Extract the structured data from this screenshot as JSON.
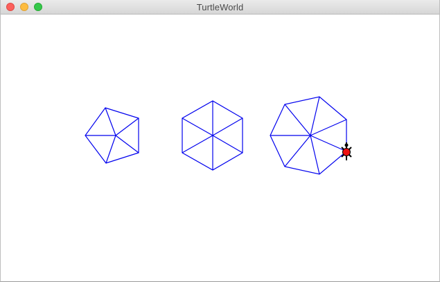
{
  "window": {
    "title": "TurtleWorld"
  },
  "colors": {
    "stroke": "#0000ee",
    "turtle_body": "#ee1111",
    "turtle_outline": "#000000",
    "background": "#ffffff"
  },
  "shapes": [
    {
      "name": "pentagon-pie",
      "sides": 5
    },
    {
      "name": "hexagon-pie",
      "sides": 6
    },
    {
      "name": "heptagon-pie",
      "sides": 7
    }
  ],
  "turtle": {
    "icon": "turtle-icon"
  }
}
